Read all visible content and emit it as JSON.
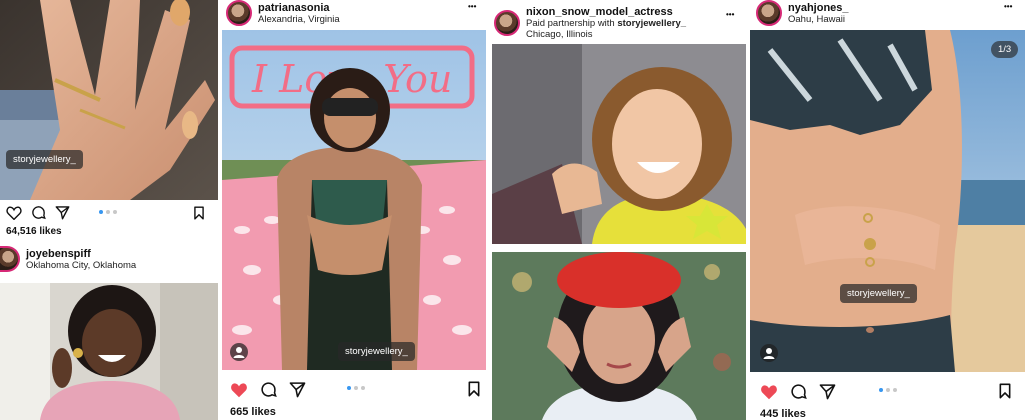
{
  "posts": [
    {
      "tag": "storyjewellery_",
      "likes": "64,516 likes"
    },
    {
      "username": "joyebenspiff",
      "location": "Oklahoma City, Oklahoma"
    },
    {
      "username": "patrianasonia",
      "location": "Alexandria, Virginia",
      "tag": "storyjewellery_",
      "likes": "665 likes"
    },
    {
      "username": "nixon_snow_model_actress",
      "partnership_prefix": "Paid partnership with ",
      "partnership_partner": "storyjewellery_",
      "location": "Chicago, Illinois"
    },
    {
      "username": "nyahjones_",
      "location": "Oahu, Hawaii",
      "tag": "storyjewellery_",
      "counter": "1/3",
      "likes": "445 likes"
    }
  ],
  "icons": {
    "more": "more-options-icon",
    "like": "heart-icon",
    "comment": "comment-icon",
    "share": "share-icon",
    "save": "bookmark-icon",
    "tagged_user": "tagged-user-icon"
  },
  "colors": {
    "like_active": "#ed4956",
    "pager_active": "#3897f0",
    "avatar_ring": "#d62976"
  },
  "ellipsis": "•••",
  "sign_text": "I Love You"
}
